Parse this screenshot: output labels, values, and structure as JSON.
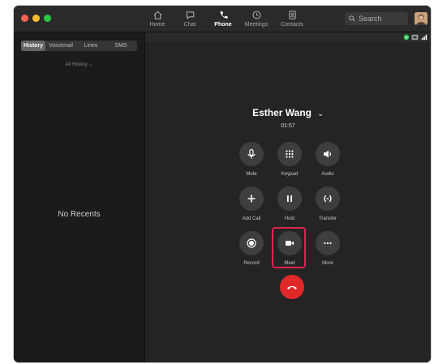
{
  "nav": {
    "items": [
      {
        "label": "Home",
        "icon": "home-icon"
      },
      {
        "label": "Chat",
        "icon": "chat-icon"
      },
      {
        "label": "Phone",
        "icon": "phone-icon",
        "active": true
      },
      {
        "label": "Meetings",
        "icon": "clock-icon"
      },
      {
        "label": "Contacts",
        "icon": "contacts-icon"
      }
    ],
    "search_label": "Search"
  },
  "sidebar": {
    "tabs": [
      "History",
      "Voicemail",
      "Lines",
      "SMS"
    ],
    "filter": "All History ⌄",
    "empty_text": "No Recents"
  },
  "call": {
    "name": "Esther Wang",
    "name_chevron": "⌄",
    "timer": "01:57",
    "controls": [
      {
        "label": "Mute",
        "icon": "microphone-icon"
      },
      {
        "label": "Keypad",
        "icon": "keypad-icon"
      },
      {
        "label": "Audio",
        "icon": "speaker-icon"
      },
      {
        "label": "Add Call",
        "icon": "plus-icon"
      },
      {
        "label": "Hold",
        "icon": "pause-icon"
      },
      {
        "label": "Transfer",
        "icon": "transfer-icon"
      },
      {
        "label": "Record",
        "icon": "record-icon"
      },
      {
        "label": "Meet",
        "icon": "video-camera-icon"
      },
      {
        "label": "More",
        "icon": "more-icon"
      }
    ]
  },
  "colors": {
    "highlight": "#e0234e",
    "end_call": "#e02828",
    "secure": "#27c24c"
  }
}
